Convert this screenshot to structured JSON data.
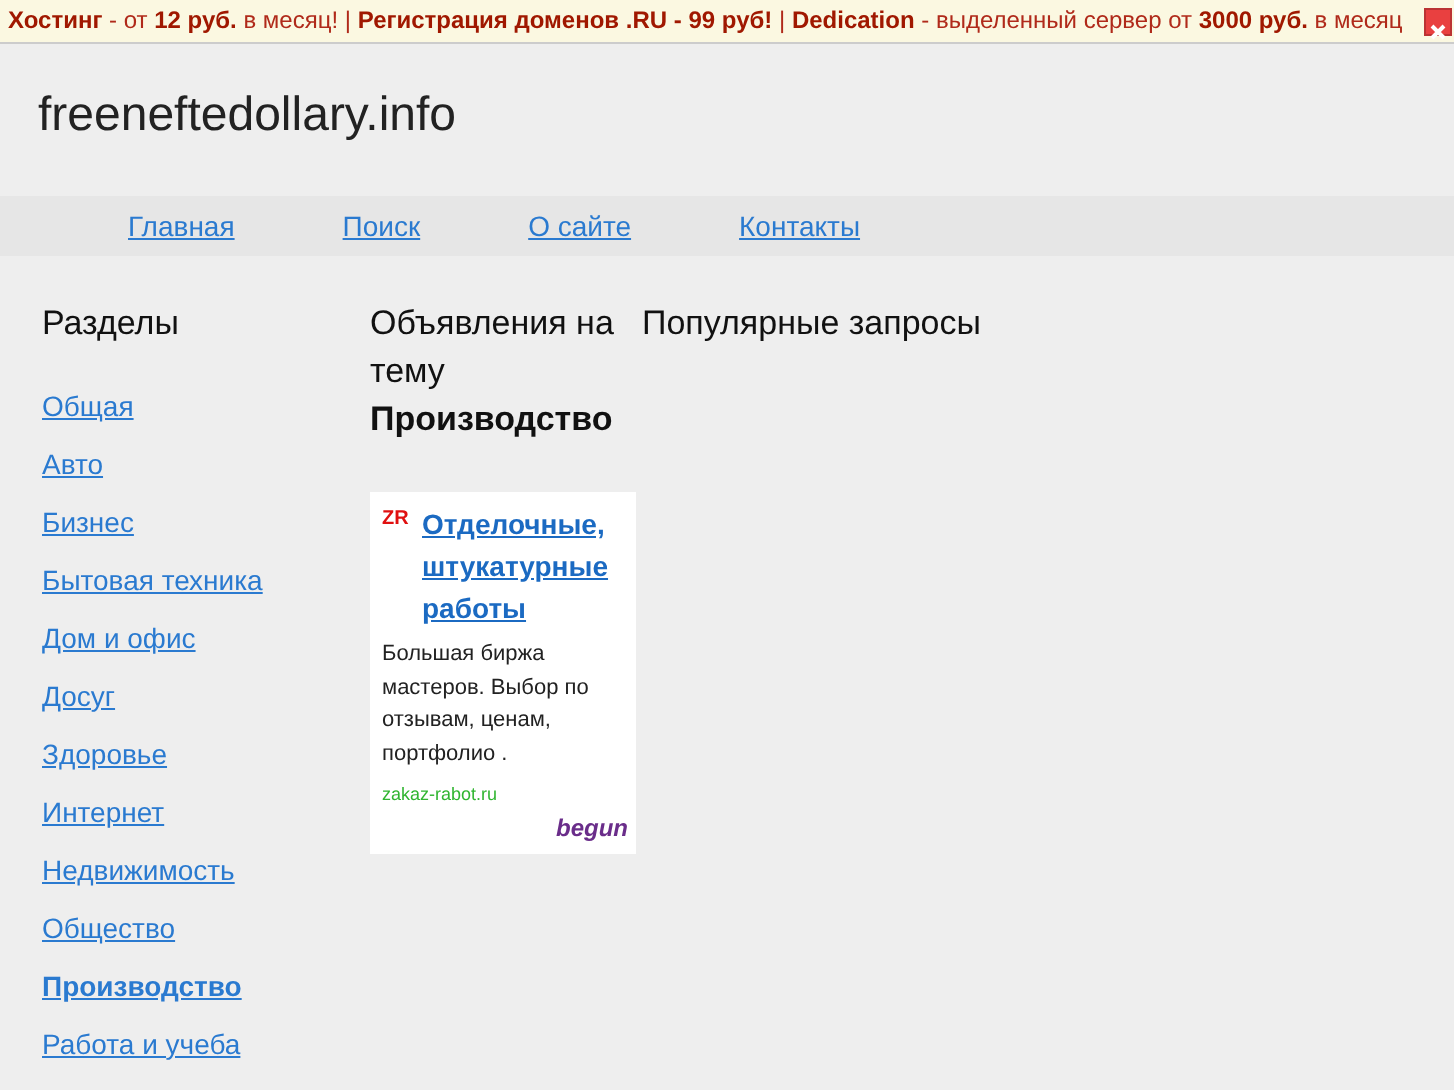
{
  "promo_bar": {
    "text": "**Хостинг** - от **12 руб.** в месяц! | **Регистрация доменов .RU - 99 руб!** | **Dedication** - выделенный сервер от **3000 руб.** в месяц"
  },
  "site_title": "freeneftedollary.info",
  "nav": [
    {
      "label": "Главная"
    },
    {
      "label": "Поиск"
    },
    {
      "label": "О сайте"
    },
    {
      "label": "Контакты"
    }
  ],
  "sidebar": {
    "title": "Разделы",
    "items": [
      {
        "label": "Общая",
        "selected": false
      },
      {
        "label": "Авто",
        "selected": false
      },
      {
        "label": "Бизнес",
        "selected": false
      },
      {
        "label": "Бытовая техника",
        "selected": false
      },
      {
        "label": "Дом и офис",
        "selected": false
      },
      {
        "label": "Досуг",
        "selected": false
      },
      {
        "label": "Здоровье",
        "selected": false
      },
      {
        "label": "Интернет",
        "selected": false
      },
      {
        "label": "Недвижимость",
        "selected": false
      },
      {
        "label": "Общество",
        "selected": false
      },
      {
        "label": "Производство",
        "selected": true
      },
      {
        "label": "Работа и учеба",
        "selected": false
      }
    ]
  },
  "ads": {
    "title": "Объявления на тему",
    "topic": "Производство",
    "ad": {
      "logo": "ZR",
      "headline": "Отделочные, штукатурные работы",
      "body": "Большая биржа мастеров. Выбор по отзывам, ценам, портфолио .",
      "domain": "zakaz-rabot.ru",
      "network": "begun"
    }
  },
  "popular": {
    "title": "Популярные запросы"
  }
}
